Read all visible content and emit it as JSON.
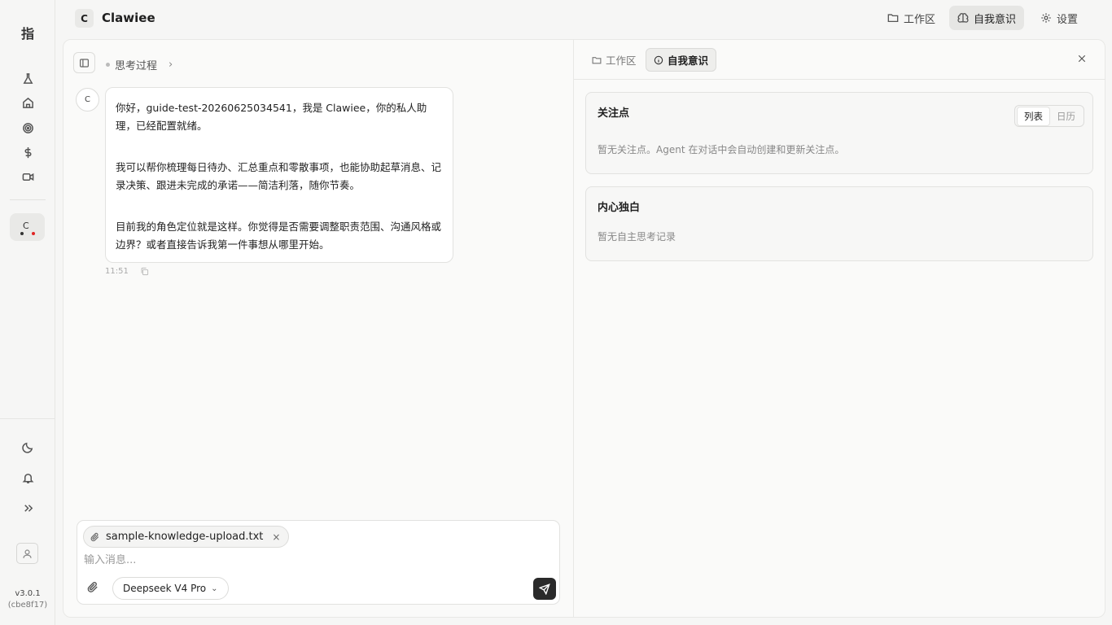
{
  "rail": {
    "logo": "指",
    "agent_initial": "C",
    "version": "v3.0.1",
    "build": "(cbe8f17)"
  },
  "header": {
    "avatar_initial": "C",
    "title": "Clawiee",
    "buttons": [
      {
        "label": "工作区",
        "icon": "folder-icon",
        "active": false
      },
      {
        "label": "自我意识",
        "icon": "brain-icon",
        "active": true
      },
      {
        "label": "设置",
        "icon": "gear-icon",
        "active": false
      }
    ]
  },
  "chat": {
    "thinking_label": "思考过程",
    "bot_initial": "C",
    "message": {
      "paragraphs": [
        "你好，guide-test-20260625034541，我是 Clawiee，你的私人助理，已经配置就绪。",
        "我可以帮你梳理每日待办、汇总重点和零散事项，也能协助起草消息、记录决策、跟进未完成的承诺——简洁利落，随你节奏。",
        "目前我的角色定位就是这样。你觉得是否需要调整职责范围、沟通风格或边界？或者直接告诉我第一件事想从哪里开始。"
      ],
      "time": "11:51"
    },
    "composer": {
      "attachment_name": "sample-knowledge-upload.txt",
      "input_value": "",
      "input_placeholder": "输入消息...",
      "model": "Deepseek V4 Pro"
    }
  },
  "panel": {
    "tabs": [
      {
        "label": "工作区",
        "icon": "folder-icon",
        "active": false
      },
      {
        "label": "自我意识",
        "icon": "info-icon",
        "active": true
      }
    ],
    "focus": {
      "title": "关注点",
      "view_options": [
        "列表",
        "日历"
      ],
      "selected_view": "列表",
      "empty_text": "暂无关注点。Agent 在对话中会自动创建和更新关注点。"
    },
    "monologue": {
      "title": "内心独白",
      "empty_text": "暂无自主思考记录"
    }
  },
  "colors": {
    "accent_dark": "#2a2a2a",
    "status_red": "#e02424",
    "background": "#f6f6f5"
  }
}
